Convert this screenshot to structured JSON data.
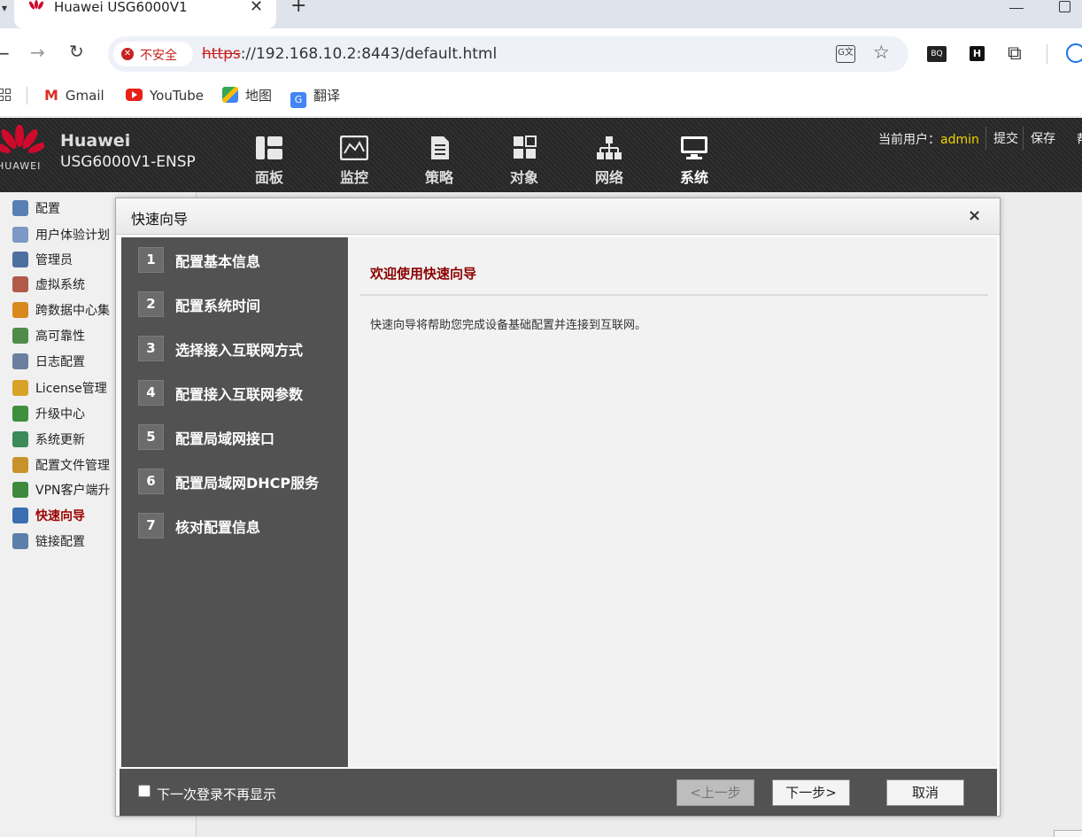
{
  "browser": {
    "tab_title": "Huawei USG6000V1",
    "tab_close": "✕",
    "new_tab": "+",
    "security_label": "不安全",
    "url_scheme": "https",
    "url_rest": "://192.168.10.2:8443/default.html",
    "bookmarks": [
      "Gmail",
      "YouTube",
      "地图",
      "翻译"
    ],
    "ext_labels": [
      "BQ",
      "H"
    ]
  },
  "header": {
    "brand_name": "Huawei",
    "brand_model": "USG6000V1-ENSP",
    "logo_text": "HUAWEI",
    "nav": [
      {
        "label": "面板",
        "icon": "dashboard-icon"
      },
      {
        "label": "监控",
        "icon": "monitor-icon"
      },
      {
        "label": "策略",
        "icon": "policy-icon"
      },
      {
        "label": "对象",
        "icon": "object-icon"
      },
      {
        "label": "网络",
        "icon": "network-icon"
      },
      {
        "label": "系统",
        "icon": "system-icon",
        "active": true
      }
    ],
    "current_user_label": "当前用户：",
    "current_user": "admin",
    "submit_label": "提交",
    "save_label": "保存",
    "more_label": "帮"
  },
  "sidebar": {
    "items": [
      {
        "label": "配置",
        "icon": "config-icon",
        "color": "#5a7fb5"
      },
      {
        "label": "用户体验计划",
        "icon": "user-experience-icon",
        "color": "#7d98c4"
      },
      {
        "label": "管理员",
        "icon": "admin-icon",
        "color": "#4d6fa0"
      },
      {
        "label": "虚拟系统",
        "icon": "virtual-system-icon",
        "color": "#b05a4a"
      },
      {
        "label": "跨数据中心集",
        "icon": "datacenter-icon",
        "color": "#d9891c"
      },
      {
        "label": "高可靠性",
        "icon": "ha-icon",
        "color": "#4f8c4a"
      },
      {
        "label": "日志配置",
        "icon": "log-icon",
        "color": "#6b7fa0"
      },
      {
        "label": "License管理",
        "icon": "license-icon",
        "color": "#d8a22a"
      },
      {
        "label": "升级中心",
        "icon": "upgrade-icon",
        "color": "#3f8f3f"
      },
      {
        "label": "系统更新",
        "icon": "update-icon",
        "color": "#3a8a5a"
      },
      {
        "label": "配置文件管理",
        "icon": "config-file-icon",
        "color": "#c8922a"
      },
      {
        "label": "VPN客户端升",
        "icon": "vpn-client-icon",
        "color": "#3d8a3d"
      },
      {
        "label": "快速向导",
        "icon": "quick-wizard-icon",
        "color": "#3b6fb0",
        "active": true
      },
      {
        "label": "链接配置",
        "icon": "link-config-icon",
        "color": "#5b7fa8"
      }
    ]
  },
  "dialog": {
    "title": "快速向导",
    "close": "×",
    "steps": [
      {
        "num": "1",
        "label": "配置基本信息"
      },
      {
        "num": "2",
        "label": "配置系统时间"
      },
      {
        "num": "3",
        "label": "选择接入互联网方式"
      },
      {
        "num": "4",
        "label": "配置接入互联网参数"
      },
      {
        "num": "5",
        "label": "配置局域网接口"
      },
      {
        "num": "6",
        "label": "配置局域网DHCP服务"
      },
      {
        "num": "7",
        "label": "核对配置信息"
      }
    ],
    "content_title": "欢迎使用快速向导",
    "content_desc": "快速向导将帮助您完成设备基础配置并连接到互联网。",
    "dont_show_label": "下一次登录不再显示",
    "prev_label": "<上一步",
    "next_label": "下一步>",
    "cancel_label": "取消"
  },
  "colors": {
    "header_bg": "#2b2b2b",
    "accent_red": "#8b0000",
    "username_yellow": "#f4d300",
    "steps_panel": "#525252"
  }
}
